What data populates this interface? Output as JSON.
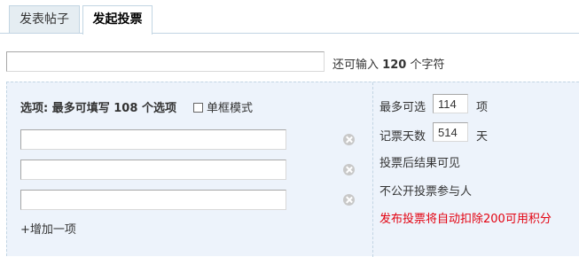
{
  "tabs": [
    {
      "label": "发表帖子",
      "active": false
    },
    {
      "label": "发起投票",
      "active": true
    }
  ],
  "subject": {
    "value": "",
    "hint_prefix": "还可输入",
    "remaining": "120",
    "hint_suffix": "个字符"
  },
  "options": {
    "header_prefix": "选项: 最多可填写",
    "max_options": "108",
    "header_suffix": "个选项",
    "single_mode_label": "单框模式",
    "items": [
      {
        "value": ""
      },
      {
        "value": ""
      },
      {
        "value": ""
      }
    ],
    "add_label": "+增加一项"
  },
  "settings": {
    "max_choice_label": "最多可选",
    "max_choice_value": "114",
    "max_choice_unit": "项",
    "days_label": "记票天数",
    "days_value": "514",
    "days_unit": "天",
    "visible_after_vote": "投票后结果可见",
    "hide_voters": "不公开投票参与人",
    "cost_notice": "发布投票将自动扣除200可用积分"
  },
  "colors": {
    "panel_bg": "#edf3fb",
    "border": "#c2d5e3",
    "tab_bg": "#e5edf2",
    "warning": "#e3000f"
  }
}
